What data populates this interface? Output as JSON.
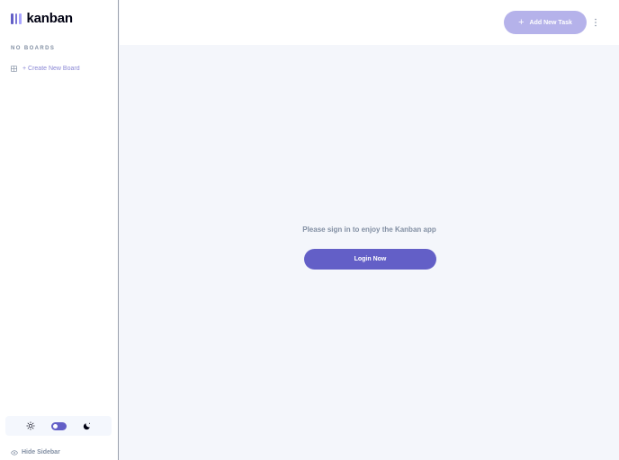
{
  "app": {
    "name": "kanban"
  },
  "sidebar": {
    "boards_heading": "No Boards",
    "create_board_label": "+ Create New Board",
    "hide_sidebar_label": "Hide Sidebar",
    "theme": {
      "mode": "dark",
      "toggle_on": true
    }
  },
  "header": {
    "add_task_label": "Add New Task",
    "add_task_icon": "+"
  },
  "main": {
    "signin_message": "Please sign in to enjoy the Kanban app",
    "login_label": "Login Now"
  },
  "colors": {
    "accent": "#635fc7",
    "accent_light": "#a8a4ff",
    "muted_text": "#828fa3",
    "background": "#f4f6fb"
  },
  "icons": [
    "logo-bars-icon",
    "board-icon",
    "plus-icon",
    "vertical-ellipsis-icon",
    "sun-icon",
    "moon-icon",
    "eye-icon"
  ]
}
